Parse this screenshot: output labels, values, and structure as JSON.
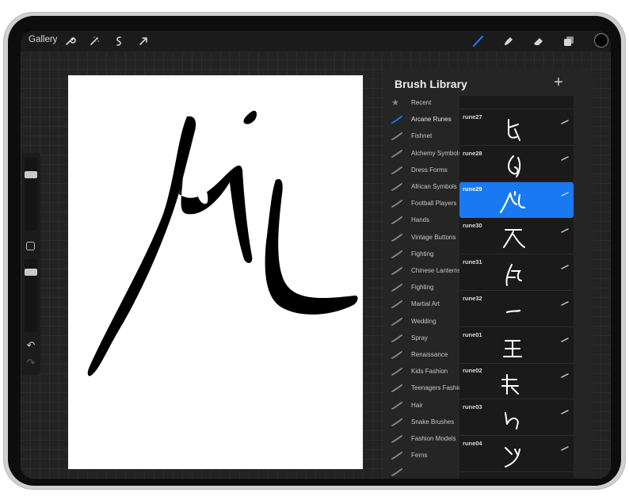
{
  "topbar": {
    "gallery_label": "Gallery",
    "left_tools": [
      "wrench-icon",
      "magic-wand-icon",
      "selection-icon",
      "transform-arrow-icon"
    ],
    "right_tools": [
      "brush-icon",
      "smudge-icon",
      "eraser-icon",
      "layers-icon"
    ],
    "active_tool": "brush-icon",
    "accent_color": "#1979f2",
    "current_color": "#000000"
  },
  "sidebar": {
    "brush_size_level": 0.2,
    "opacity_level": 0.6
  },
  "brush_library": {
    "title": "Brush Library",
    "add_label": "+",
    "categories": [
      {
        "label": "Recent",
        "icon": "star-icon"
      },
      {
        "label": "Arcane Runes",
        "icon": "brush-stroke-icon",
        "active": true
      },
      {
        "label": "Fishnet",
        "icon": "brush-stroke-icon"
      },
      {
        "label": "Alchemy Symbols",
        "icon": "brush-stroke-icon"
      },
      {
        "label": "Dress Forms",
        "icon": "brush-stroke-icon"
      },
      {
        "label": "African Symbols",
        "icon": "brush-stroke-icon"
      },
      {
        "label": "Football Players",
        "icon": "brush-stroke-icon"
      },
      {
        "label": "Hands",
        "icon": "brush-stroke-icon"
      },
      {
        "label": "Vintage Buttons",
        "icon": "brush-stroke-icon"
      },
      {
        "label": "Fighting",
        "icon": "brush-stroke-icon"
      },
      {
        "label": "Chinese Lanterns",
        "icon": "brush-stroke-icon"
      },
      {
        "label": "Fighting",
        "icon": "brush-stroke-icon"
      },
      {
        "label": "Martial Art",
        "icon": "brush-stroke-icon"
      },
      {
        "label": "Wedding",
        "icon": "brush-stroke-icon"
      },
      {
        "label": "Spray",
        "icon": "brush-stroke-icon"
      },
      {
        "label": "Renaissance",
        "icon": "brush-stroke-icon"
      },
      {
        "label": "Kids Fashion",
        "icon": "brush-stroke-icon"
      },
      {
        "label": "Teenagers Fashion",
        "icon": "brush-stroke-icon"
      },
      {
        "label": "Hair",
        "icon": "brush-stroke-icon"
      },
      {
        "label": "Snake Brushes",
        "icon": "brush-stroke-icon"
      },
      {
        "label": "Fashion Models",
        "icon": "brush-stroke-icon"
      },
      {
        "label": "Ferns",
        "icon": "brush-stroke-icon"
      },
      {
        "label": "",
        "icon": "brush-stroke-icon"
      }
    ],
    "brushes": [
      {
        "name": "",
        "selected": false
      },
      {
        "name": "rune27",
        "selected": false
      },
      {
        "name": "rune28",
        "selected": false
      },
      {
        "name": "rune29",
        "selected": true
      },
      {
        "name": "rune30",
        "selected": false
      },
      {
        "name": "rune31",
        "selected": false
      },
      {
        "name": "rune32",
        "selected": false
      },
      {
        "name": "rune01",
        "selected": false
      },
      {
        "name": "rune02",
        "selected": false
      },
      {
        "name": "rune03",
        "selected": false
      },
      {
        "name": "rune04",
        "selected": false
      }
    ]
  }
}
